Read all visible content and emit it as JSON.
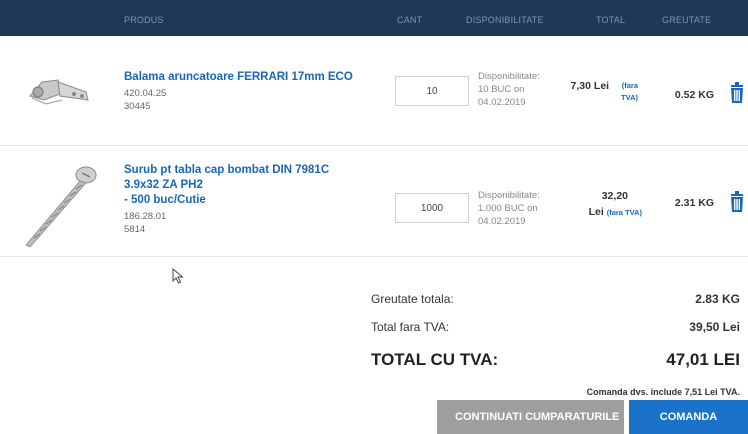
{
  "header": {
    "col_product": "PRODUS",
    "col_qty": "CANT",
    "col_availability": "DISPONIBILITATE",
    "col_total": "TOTAL",
    "col_weight": "GREUTATE"
  },
  "items": [
    {
      "name_lines": [
        "Balama aruncatoare FERRARI 17mm ECO"
      ],
      "code1": "420.04.25",
      "code2": "30445",
      "qty": "10",
      "availability": [
        "Disponibilitate:",
        "10 BUC on",
        "04.02.2019"
      ],
      "price_value": "7,30 Lei",
      "price_note": "(fara TVA)",
      "weight": "0.52 KG"
    },
    {
      "name_lines": [
        "Surub pt tabla cap bombat DIN 7981C",
        "3.9x32 ZA PH2",
        "- 500 buc/Cutie"
      ],
      "code1": "186.28.01",
      "code2": "5814",
      "qty": "1000",
      "availability": [
        "Disponibilitate:",
        "1.000 BUC on",
        "04.02.2019"
      ],
      "price_value": "32,20",
      "price_unit": "Lei",
      "price_note": "(fara TVA)",
      "weight": "2.31 KG"
    }
  ],
  "summary": {
    "weight_label": "Greutate totala:",
    "weight_value": "2.83 KG",
    "net_label": "Total fara TVA:",
    "net_value": "39,50 Lei",
    "total_label": "TOTAL CU TVA:",
    "total_value": "47,01 LEI",
    "vat_note": "Comanda dvs. include 7,51 Lei TVA."
  },
  "buttons": {
    "continue_label": "CONTINUATI CUMPARATURILE",
    "order_label": "COMANDA"
  },
  "colors": {
    "header_bg": "#1e3858",
    "link_blue": "#1a66b8",
    "order_button": "#1a73c9",
    "continue_button": "#9e9e9e"
  },
  "icons": {
    "delete": "trash-icon",
    "pointer": "mouse-cursor-icon"
  }
}
